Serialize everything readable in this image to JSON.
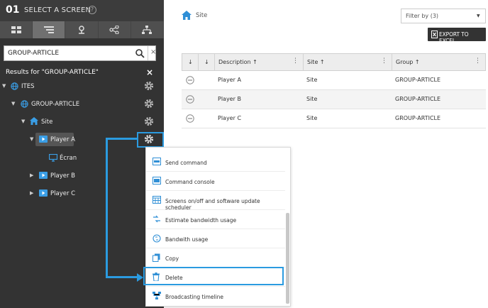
{
  "left_panel": {
    "step_number": "01",
    "title": "SELECT A SCREEN",
    "help_label": "?",
    "tabs": [
      {
        "icon": "grid-icon"
      },
      {
        "icon": "filter-list-icon"
      },
      {
        "icon": "map-pin-icon"
      },
      {
        "icon": "share-network-icon"
      },
      {
        "icon": "hierarchy-icon"
      }
    ],
    "active_tab": 1,
    "search": {
      "value": "GROUP-ARTICLE",
      "clear_label": "×"
    },
    "results_label": "Results for \"GROUP-ARTICLE\"",
    "results_close": "×",
    "tree": [
      {
        "label": "ITES",
        "icon": "globe-icon",
        "expand": "▼"
      },
      {
        "label": "GROUP-ARTICLE",
        "icon": "globe-icon",
        "expand": "▼"
      },
      {
        "label": "Site",
        "icon": "home-icon",
        "expand": "▼"
      },
      {
        "label": "Player A",
        "icon": "player-icon",
        "expand": "▼"
      },
      {
        "label": "Écran",
        "icon": "monitor-icon",
        "expand": ""
      },
      {
        "label": "Player B",
        "icon": "player-icon",
        "expand": "▶"
      },
      {
        "label": "Player C",
        "icon": "player-icon",
        "expand": "▶"
      }
    ]
  },
  "content": {
    "breadcrumb": "Site",
    "filter_label": "Filter by (3)",
    "export_label": "EXPORT TO EXCEL",
    "table": {
      "columns": [
        {
          "label": "↓"
        },
        {
          "label": "↓"
        },
        {
          "label": "Description ↑"
        },
        {
          "label": "Site ↑"
        },
        {
          "label": "Group ↑"
        }
      ],
      "rows": [
        {
          "description": "Player A",
          "site": "Site",
          "group": "GROUP-ARTICLE"
        },
        {
          "description": "Player B",
          "site": "Site",
          "group": "GROUP-ARTICLE"
        },
        {
          "description": "Player C",
          "site": "Site",
          "group": "GROUP-ARTICLE"
        }
      ]
    }
  },
  "context_menu": {
    "items": [
      {
        "label": "Send command",
        "icon": "command-icon"
      },
      {
        "label": "Command console",
        "icon": "console-icon"
      },
      {
        "label": "Screens on/off and software update scheduler",
        "icon": "calendar-icon"
      },
      {
        "label": "Estimate bandwidth usage",
        "icon": "bandwidth-estimate-icon"
      },
      {
        "label": "Bandwith usage",
        "icon": "bandwidth-icon"
      },
      {
        "label": "Copy",
        "icon": "copy-icon"
      },
      {
        "label": "Delete",
        "icon": "trash-icon"
      },
      {
        "label": "Broadcasting timeline",
        "icon": "timeline-icon"
      }
    ],
    "highlighted_item": "Delete"
  },
  "colors": {
    "accent": "#2b9be0",
    "sidebar_bg": "#333333",
    "icon_blue": "#2f8fd6"
  }
}
